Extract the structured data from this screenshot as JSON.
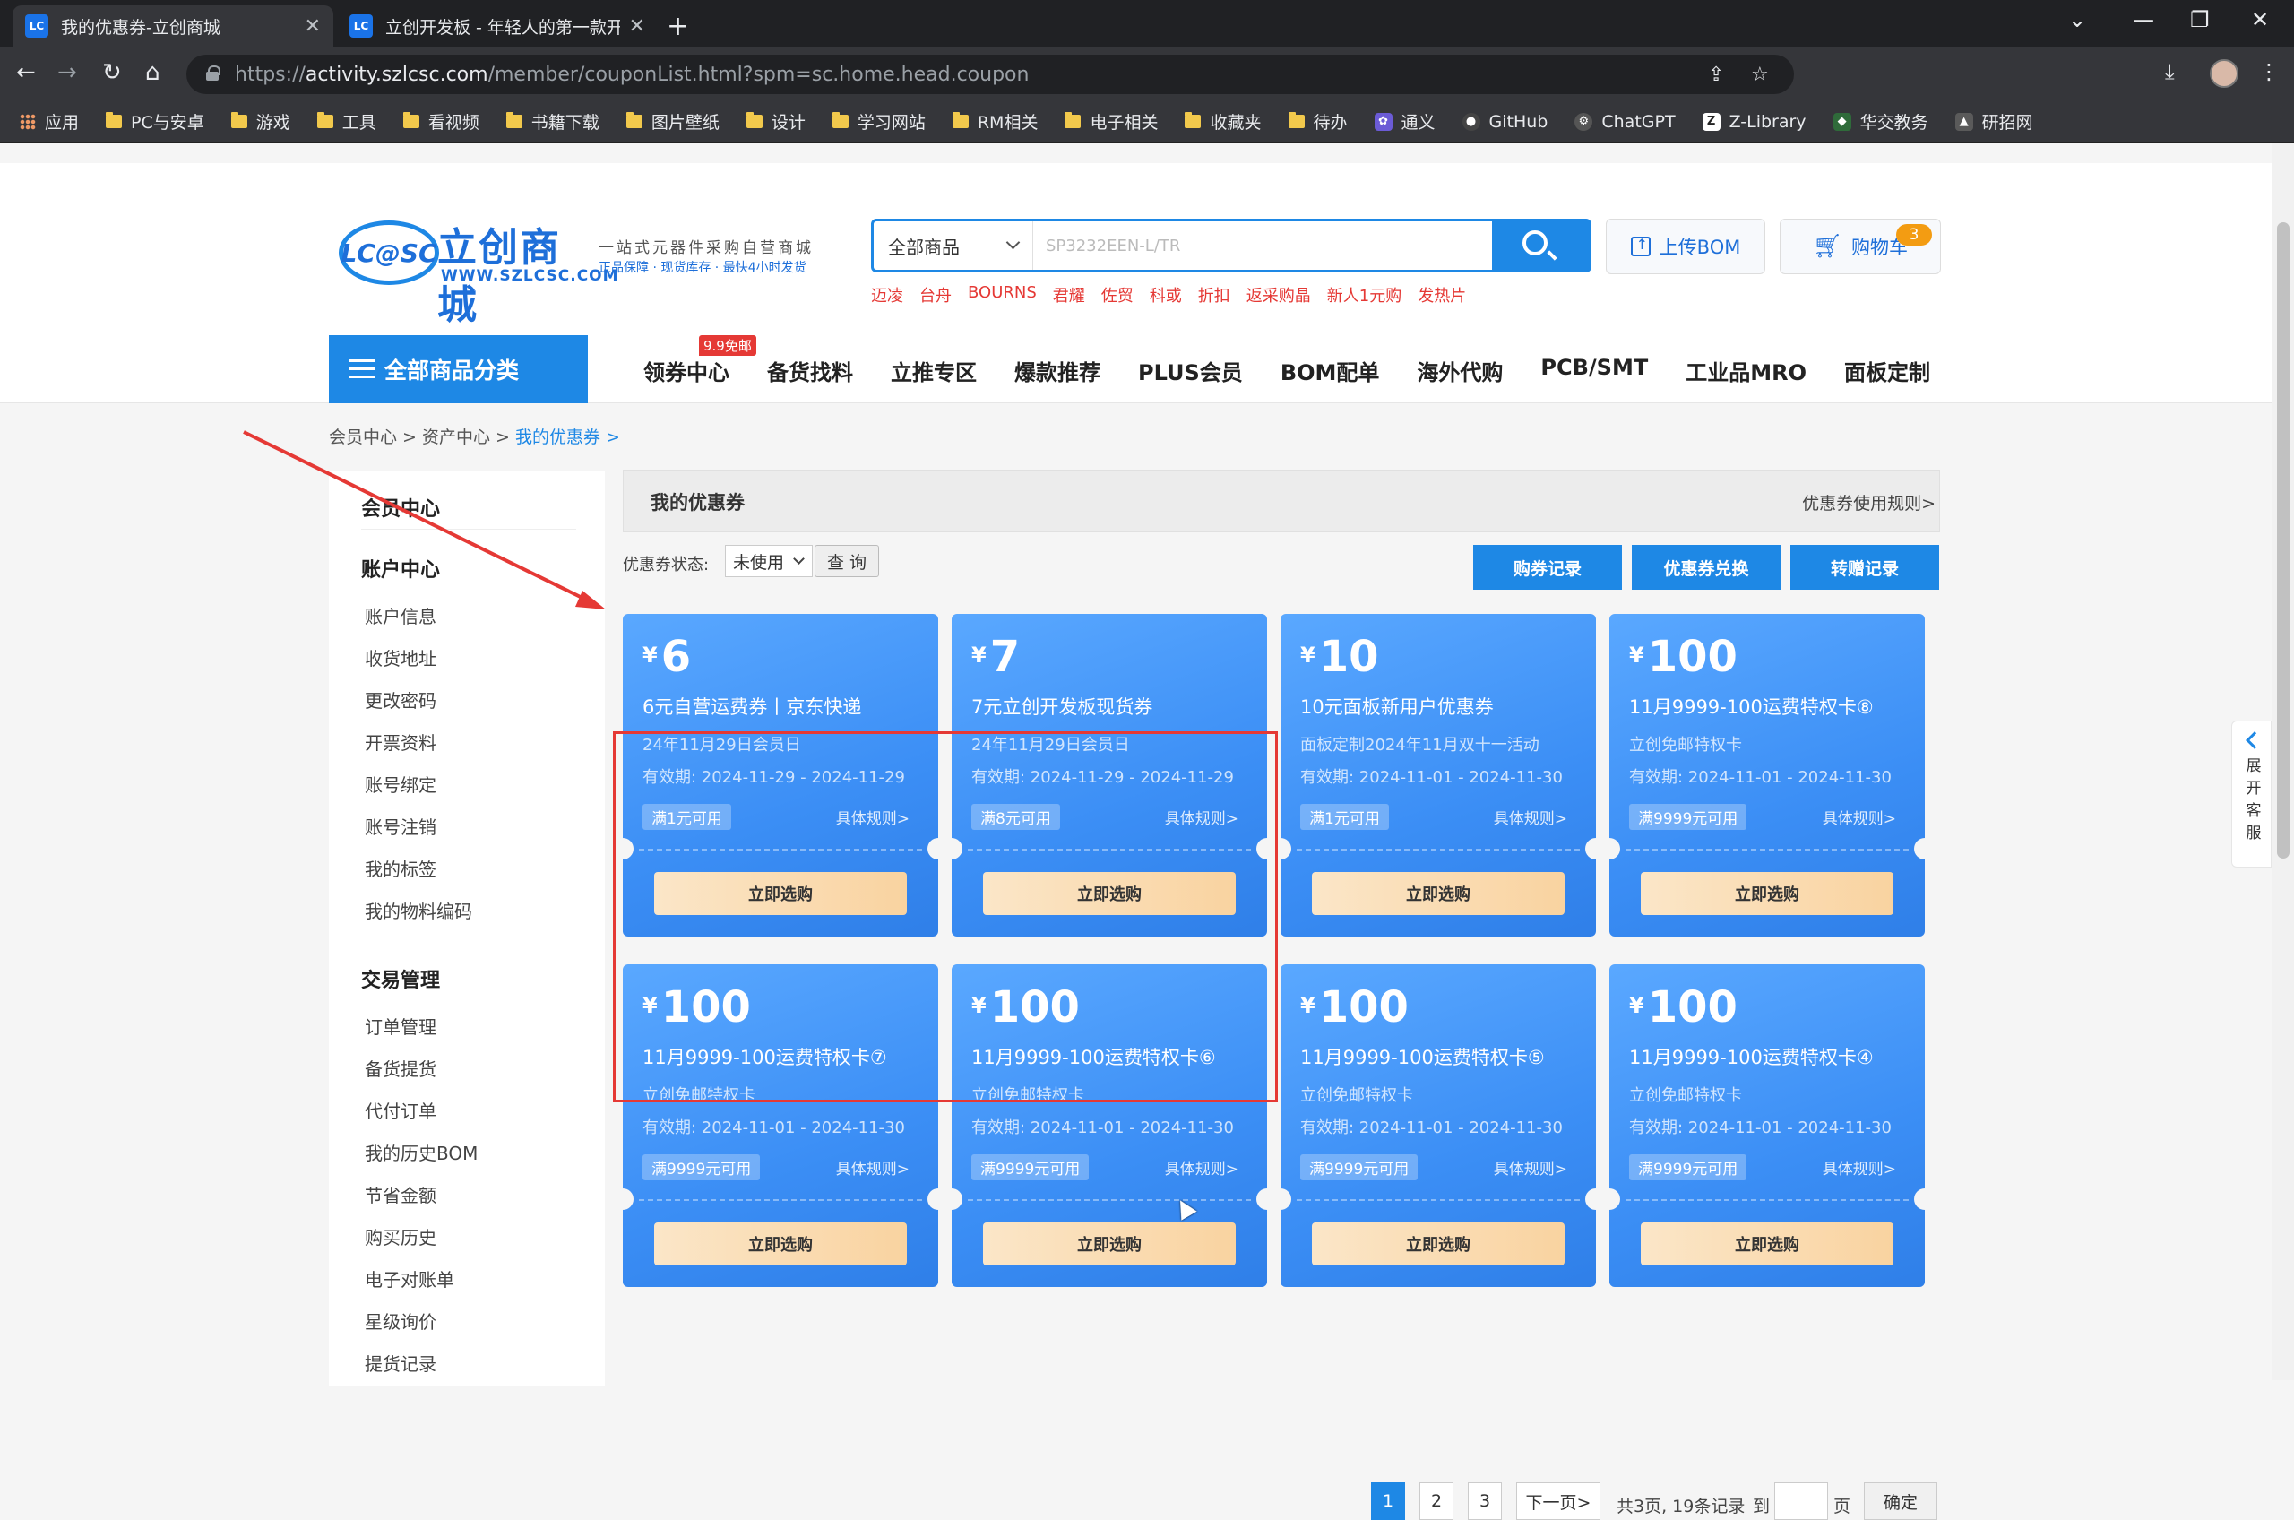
{
  "browser": {
    "tabs": [
      {
        "favicon": "LC",
        "title": "我的优惠券-立创商城"
      },
      {
        "favicon": "LC",
        "title": "立创开发板 - 年轻人的第一款开"
      }
    ],
    "url_prefix": "https://",
    "url_host": "activity.szlcsc.com",
    "url_path": "/member/couponList.html?spm=sc.home.head.coupon",
    "bookmarks": [
      "应用",
      "PC与安卓",
      "游戏",
      "工具",
      "看视频",
      "书籍下载",
      "图片壁纸",
      "设计",
      "学习网站",
      "RM相关",
      "电子相关",
      "收藏夹",
      "待办",
      "通义",
      "GitHub",
      "ChatGPT",
      "Z-Library",
      "华交教务",
      "研招网"
    ]
  },
  "header": {
    "logo_mark": "LC@SC",
    "logo_name": "立创商城",
    "logo_url": "WWW.SZLCSC.COM",
    "slogan": "一站式元器件采购自营商城",
    "slogan_sub": "正品保障 · 现货库存 · 最快4小时发货",
    "search_category": "全部商品",
    "search_placeholder": "SP3232EEN-L/TR",
    "hot_keywords": [
      "迈凌",
      "台舟",
      "BOURNS",
      "君耀",
      "佐贸",
      "科或",
      "折扣",
      "返采购晶",
      "新人1元购",
      "发热片"
    ],
    "bom_label": "上传BOM",
    "cart_label": "购物车",
    "cart_count": "3"
  },
  "nav": {
    "all_categories": "全部商品分类",
    "tag": "9.9免邮",
    "items": [
      "领券中心",
      "备货找料",
      "立推专区",
      "爆款推荐",
      "PLUS会员",
      "BOM配单",
      "海外代购",
      "PCB/SMT",
      "工业品MRO",
      "面板定制"
    ]
  },
  "breadcrumb": [
    "会员中心 > ",
    "资产中心 > ",
    "我的优惠券 >"
  ],
  "sidebar": {
    "title": "会员中心",
    "groups": [
      {
        "title": "账户中心",
        "items": [
          "账户信息",
          "收货地址",
          "更改密码",
          "开票资料",
          "账号绑定",
          "账号注销",
          "我的标签",
          "我的物料编码"
        ]
      },
      {
        "title": "交易管理",
        "items": [
          "订单管理",
          "备货提货",
          "代付订单",
          "我的历史BOM",
          "节省金额",
          "购买历史",
          "电子对账单",
          "星级询价",
          "提货记录"
        ]
      }
    ]
  },
  "content": {
    "title": "我的优惠券",
    "rules_link": "优惠券使用规则>",
    "filter_label": "优惠券状态:",
    "filter_value": "未使用",
    "query_button": "查 询",
    "actions": [
      "购券记录",
      "优惠券兑换",
      "转赠记录"
    ],
    "yen": "¥",
    "coupons": [
      {
        "amount": "6",
        "name": "6元自营运费券丨京东快递",
        "sub": "24年11月29日会员日",
        "valid": "有效期:   2024-11-29 - 2024-11-29",
        "cond": "满1元可用",
        "rules": "具体规则>",
        "buy": "立即选购"
      },
      {
        "amount": "7",
        "name": "7元立创开发板现货券",
        "sub": "24年11月29日会员日",
        "valid": "有效期:   2024-11-29 - 2024-11-29",
        "cond": "满8元可用",
        "rules": "具体规则>",
        "buy": "立即选购"
      },
      {
        "amount": "10",
        "name": "10元面板新用户优惠券",
        "sub": "面板定制2024年11月双十一活动",
        "valid": "有效期:   2024-11-01 - 2024-11-30",
        "cond": "满1元可用",
        "rules": "具体规则>",
        "buy": "立即选购"
      },
      {
        "amount": "100",
        "name": "11月9999-100运费特权卡⑧",
        "sub": "立创免邮特权卡",
        "valid": "有效期:   2024-11-01 - 2024-11-30",
        "cond": "满9999元可用",
        "rules": "具体规则>",
        "buy": "立即选购"
      },
      {
        "amount": "100",
        "name": "11月9999-100运费特权卡⑦",
        "sub": "立创免邮特权卡",
        "valid": "有效期:   2024-11-01 - 2024-11-30",
        "cond": "满9999元可用",
        "rules": "具体规则>",
        "buy": "立即选购"
      },
      {
        "amount": "100",
        "name": "11月9999-100运费特权卡⑥",
        "sub": "立创免邮特权卡",
        "valid": "有效期:   2024-11-01 - 2024-11-30",
        "cond": "满9999元可用",
        "rules": "具体规则>",
        "buy": "立即选购"
      },
      {
        "amount": "100",
        "name": "11月9999-100运费特权卡⑤",
        "sub": "立创免邮特权卡",
        "valid": "有效期:   2024-11-01 - 2024-11-30",
        "cond": "满9999元可用",
        "rules": "具体规则>",
        "buy": "立即选购"
      },
      {
        "amount": "100",
        "name": "11月9999-100运费特权卡④",
        "sub": "立创免邮特权卡",
        "valid": "有效期:   2024-11-01 - 2024-11-30",
        "cond": "满9999元可用",
        "rules": "具体规则>",
        "buy": "立即选购"
      }
    ]
  },
  "pagination": {
    "pages": [
      "1",
      "2",
      "3"
    ],
    "next": "下一页>",
    "summary": "共3页, 19条记录",
    "goto": "到",
    "page_unit": "页",
    "confirm": "确定"
  },
  "float_service": "展开客服"
}
